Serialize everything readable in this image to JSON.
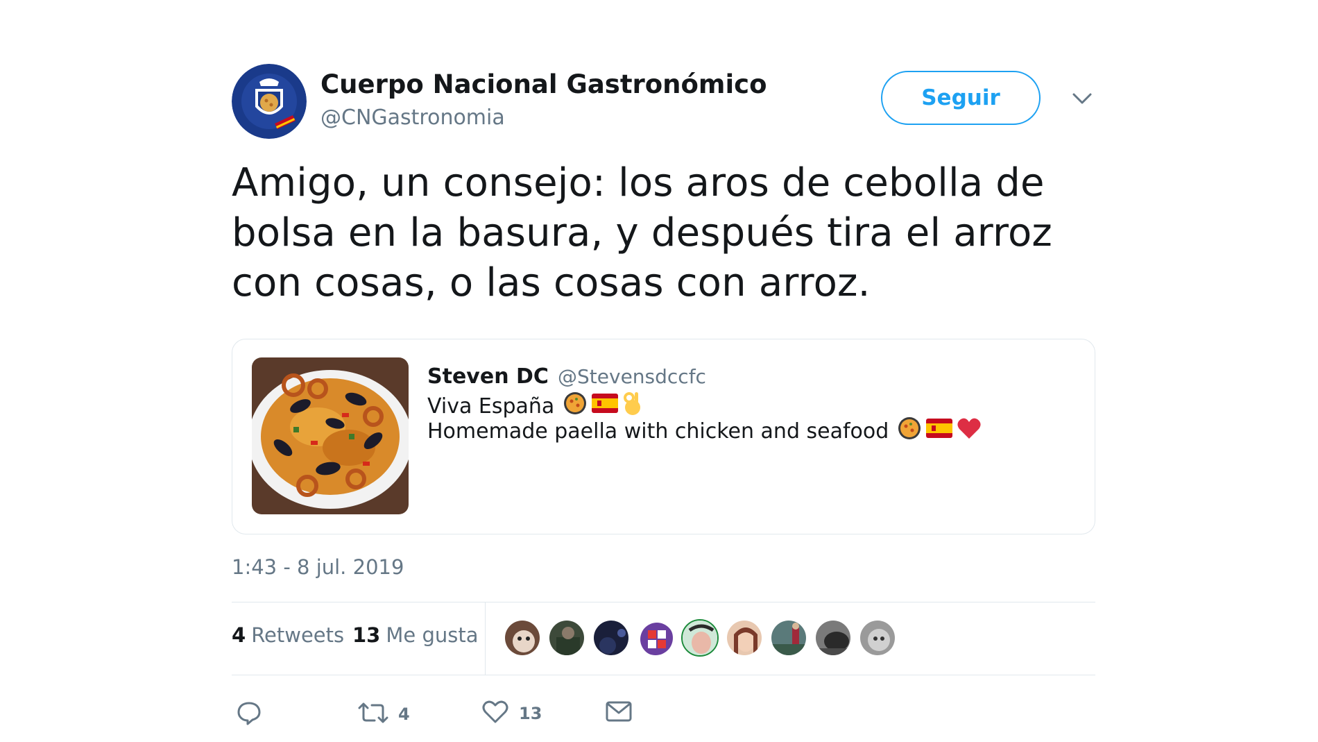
{
  "author": {
    "name": "Cuerpo Nacional Gastronómico",
    "handle": "@CNGastronomia",
    "follow_label": "Seguir"
  },
  "tweet": {
    "text": "Amigo, un consejo: los aros de cebolla de bolsa en la basura, y después tira el arroz con cosas, o las cosas con arroz.",
    "timestamp": "1:43 - 8 jul. 2019"
  },
  "quote": {
    "name": "Steven DC",
    "handle": "@Stevensdccfc",
    "line1": "Viva España",
    "line2": "Homemade paella with chicken and seafood",
    "line1_emojis": [
      "paella-emoji",
      "spain-flag-emoji",
      "ok-hand-emoji"
    ],
    "line2_emojis": [
      "paella-emoji",
      "spain-flag-emoji",
      "red-heart-emoji"
    ]
  },
  "stats": {
    "retweets_count": "4",
    "retweets_label": "Retweets",
    "likes_count": "13",
    "likes_label": "Me gusta"
  },
  "actions": {
    "reply_icon": "reply-icon",
    "retweet_icon": "retweet-icon",
    "retweet_count": "4",
    "like_icon": "heart-icon",
    "like_count": "13",
    "dm_icon": "envelope-icon"
  },
  "colors": {
    "accent": "#1da1f2",
    "text": "#14171a",
    "secondary": "#657786",
    "border": "#e1e8ed"
  }
}
